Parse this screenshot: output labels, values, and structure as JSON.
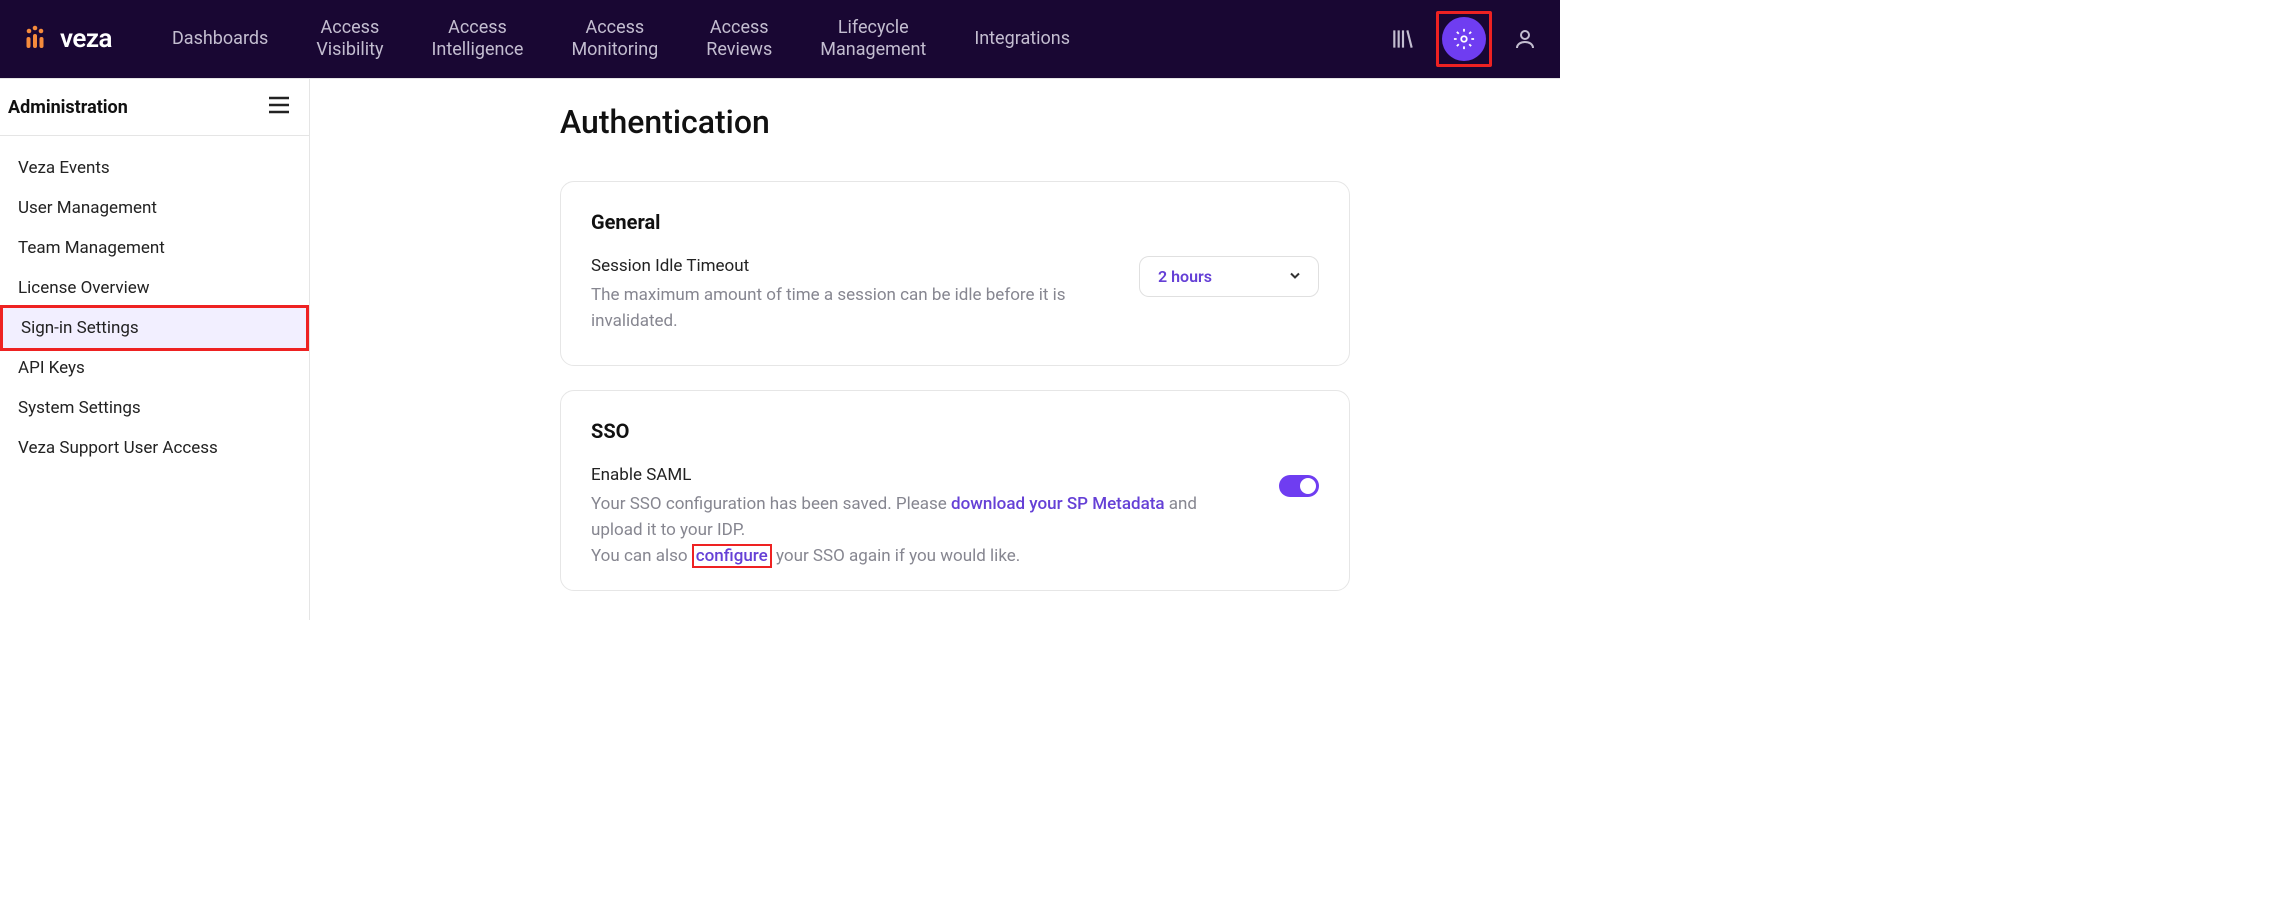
{
  "brand": "veza",
  "nav": [
    "Dashboards",
    "Access\nVisibility",
    "Access\nIntelligence",
    "Access\nMonitoring",
    "Access\nReviews",
    "Lifecycle\nManagement",
    "Integrations"
  ],
  "sidebar": {
    "title": "Administration",
    "items": [
      "Veza Events",
      "User Management",
      "Team Management",
      "License Overview",
      "Sign-in Settings",
      "API Keys",
      "System Settings",
      "Veza Support User Access"
    ],
    "active_index": 4
  },
  "page": {
    "title": "Authentication",
    "general": {
      "title": "General",
      "field_label": "Session Idle Timeout",
      "field_desc": "The maximum amount of time a session can be idle before it is invalidated.",
      "select_value": "2 hours"
    },
    "sso": {
      "title": "SSO",
      "field_label": "Enable SAML",
      "desc_prefix": "Your SSO configuration has been saved. Please ",
      "desc_link1": "download your SP Metadata",
      "desc_mid": " and upload it to your IDP.",
      "desc2_prefix": "You can also ",
      "desc2_link": "configure",
      "desc2_suffix": " your SSO again if you would like."
    }
  }
}
